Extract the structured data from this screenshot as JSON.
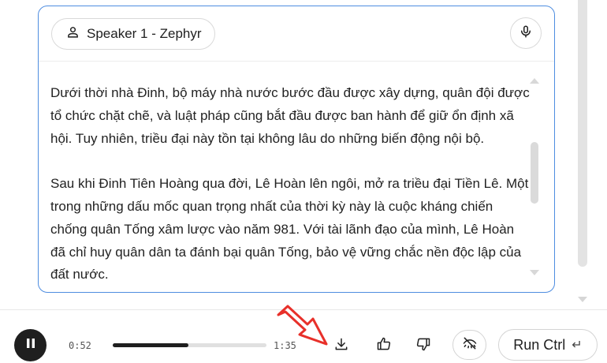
{
  "speaker_card": {
    "speaker_label": "Speaker 1 - Zephyr",
    "paragraphs": [
      "Dưới thời nhà Đinh, bộ máy nhà nước bước đầu được xây dựng, quân đội được tổ chức chặt chẽ, và luật pháp cũng bắt đầu được ban hành để giữ ổn định xã hội. Tuy nhiên, triều đại này tồn tại không lâu do những biến động nội bộ.",
      "Sau khi Đinh Tiên Hoàng qua đời, Lê Hoàn lên ngôi, mở ra triều đại Tiền Lê. Một trong những dấu mốc quan trọng nhất của thời kỳ này là cuộc kháng chiến chống quân Tống xâm lược vào năm 981. Với tài lãnh đạo của mình, Lê Hoàn đã chỉ huy quân dân ta đánh bại quân Tống, bảo vệ vững chắc nền độc lập của đất nước."
    ]
  },
  "player": {
    "current_time": "0:52",
    "duration": "1:35",
    "progress_fraction": 0.49
  },
  "run_button": {
    "label": "Run Ctrl",
    "shortcut_glyph": "↵"
  },
  "icons": {
    "speaker": "person-icon",
    "mic": "mic-icon",
    "pause": "pause-icon",
    "download": "download-icon",
    "like": "thumbs-up-icon",
    "dislike": "thumbs-down-icon",
    "hide": "eye-off-icon"
  },
  "colors": {
    "card_border": "#4e8de0",
    "annotation": "#e8302a",
    "dark": "#1f1f1f"
  }
}
